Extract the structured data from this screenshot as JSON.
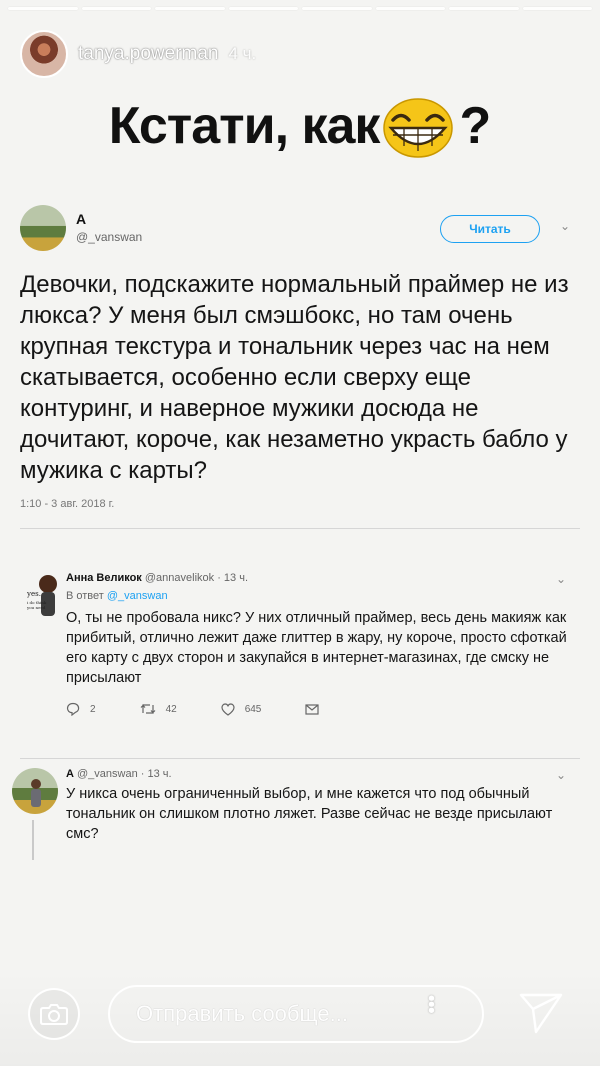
{
  "story": {
    "progress_segments": 8,
    "username": "tanya.powerman",
    "time": "4 ч.",
    "caption": "Кстати, как",
    "caption_q": "?",
    "caption_emoji": "grinning-emoji"
  },
  "tweet": {
    "name": "А",
    "handle": "@_vanswan",
    "follow_label": "Читать",
    "text": "Девочки, подскажите нормальный праймер не из люкса? У меня был смэшбокс,  но там очень крупная текстура и тональник через час на нем скатывается,  особенно если сверху еще контуринг, и наверное мужики досюда не дочитают, короче, как незаметно украсть бабло у мужика с карты?",
    "date": "1:10 - 3 авг. 2018 г."
  },
  "replies": [
    {
      "name": "Анна Великок",
      "handle": "@annavelikok",
      "time": "· 13 ч.",
      "reply_to_prefix": "В ответ",
      "reply_to": "@_vanswan",
      "text": "О, ты не пробовала никс? У них отличный праймер, весь день макияж как прибитый, отлично лежит даже глиттер в жару, ну короче, просто сфоткай его карту с двух сторон и закупайся в интернет-магазинах, где смску не присылают",
      "replies_count": "2",
      "retweets_count": "42",
      "likes_count": "645"
    },
    {
      "name": "А",
      "handle": "@_vanswan",
      "time": "· 13 ч.",
      "text": "У никса очень ограниченный выбор, и мне кажется что под обычный тональник он слишком плотно ляжет. Разве сейчас не везде присылают смс?"
    }
  ],
  "bottom": {
    "message_placeholder": "Отправить сообще..."
  },
  "colors": {
    "background": "#f4f4f2",
    "twitter_blue": "#1da1f2"
  }
}
